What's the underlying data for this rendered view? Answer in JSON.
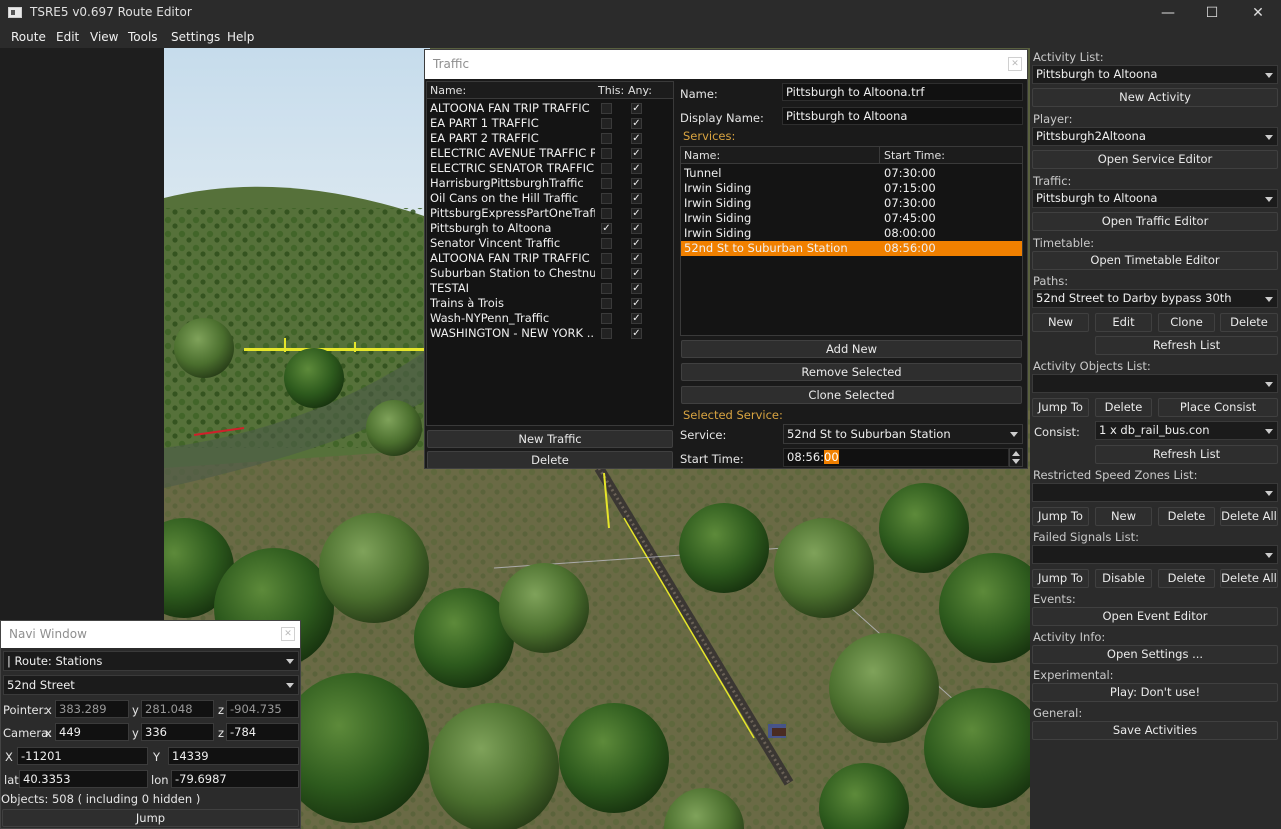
{
  "window": {
    "title": "TSRE5 v0.697 Route Editor",
    "minimize": "—",
    "maximize": "☐",
    "close": "✕"
  },
  "menu": [
    "Route",
    "Edit",
    "View",
    "Tools",
    "Settings",
    "Help"
  ],
  "traffic_window": {
    "title": "Traffic",
    "list_headers": {
      "name": "Name:",
      "this": "This:",
      "any": "Any:"
    },
    "check_glyph": "✓",
    "items": [
      {
        "name": "ALTOONA FAN TRIP TRAFFIC",
        "this": false,
        "any": true
      },
      {
        "name": "EA PART 1 TRAFFIC",
        "this": false,
        "any": true
      },
      {
        "name": "EA PART 2 TRAFFIC",
        "this": false,
        "any": true
      },
      {
        "name": "ELECTRIC AVENUE TRAFFIC P...",
        "this": false,
        "any": true
      },
      {
        "name": "ELECTRIC SENATOR TRAFFIC",
        "this": false,
        "any": true
      },
      {
        "name": "HarrisburgPittsburghTraffic",
        "this": false,
        "any": true
      },
      {
        "name": "Oil Cans on the Hill Traffic",
        "this": false,
        "any": true
      },
      {
        "name": "PittsburgExpressPartOneTraffic",
        "this": false,
        "any": true
      },
      {
        "name": "Pittsburgh to Altoona",
        "this": true,
        "any": true
      },
      {
        "name": "Senator Vincent Traffic",
        "this": false,
        "any": true
      },
      {
        "name": "ALTOONA FAN TRIP TRAFFIC",
        "this": false,
        "any": true
      },
      {
        "name": "Suburban Station to Chestnu...",
        "this": false,
        "any": true
      },
      {
        "name": "TESTAI",
        "this": false,
        "any": true
      },
      {
        "name": "Trains à Trois",
        "this": false,
        "any": true
      },
      {
        "name": "Wash-NYPenn_Traffic",
        "this": false,
        "any": true
      },
      {
        "name": "WASHINGTON - NEW YORK ...",
        "this": false,
        "any": true
      }
    ],
    "new_traffic": "New Traffic",
    "delete": "Delete",
    "name_label": "Name:",
    "name_value": "Pittsburgh to Altoona.trf",
    "display_name_label": "Display Name:",
    "display_name_value": "Pittsburgh to Altoona",
    "services_label": "Services:",
    "services_headers": {
      "name": "Name:",
      "start": "Start Time:"
    },
    "services": [
      {
        "name": "Tunnel",
        "start": "07:30:00",
        "selected": false
      },
      {
        "name": "Irwin Siding",
        "start": "07:15:00",
        "selected": false
      },
      {
        "name": "Irwin Siding",
        "start": "07:30:00",
        "selected": false
      },
      {
        "name": "Irwin Siding",
        "start": "07:45:00",
        "selected": false
      },
      {
        "name": "Irwin Siding",
        "start": "08:00:00",
        "selected": false
      },
      {
        "name": "52nd St to Suburban Station",
        "start": "08:56:00",
        "selected": true
      }
    ],
    "add_new": "Add New",
    "remove_selected": "Remove Selected",
    "clone_selected": "Clone Selected",
    "selected_service_label": "Selected Service:",
    "service_label": "Service:",
    "service_value": "52nd St to Suburban Station",
    "start_time_label": "Start Time:",
    "start_time_prefix": "08:56:",
    "start_time_highlight": "00",
    "selection_color": "#f08000"
  },
  "right_panel": {
    "activity_list_label": "Activity List:",
    "activity_value": "Pittsburgh to Altoona",
    "new_activity": "New Activity",
    "player_label": "Player:",
    "player_value": "Pittsburgh2Altoona",
    "open_service_editor": "Open Service Editor",
    "traffic_label": "Traffic:",
    "traffic_value": "Pittsburgh to Altoona",
    "open_traffic_editor": "Open Traffic Editor",
    "timetable_label": "Timetable:",
    "open_timetable_editor": "Open Timetable Editor",
    "paths_label": "Paths:",
    "paths_value": "52nd Street to Darby bypass 30th",
    "path_buttons": [
      "New",
      "Edit",
      "Clone",
      "Delete"
    ],
    "refresh_list": "Refresh List",
    "activity_objects_label": "Activity Objects List:",
    "jump_to": "Jump To",
    "delete": "Delete",
    "place_consist": "Place Consist",
    "consist_label": "Consist:",
    "consist_value": "1 x db_rail_bus.con",
    "restricted_label": "Restricted Speed Zones List:",
    "new": "New",
    "delete_all": "Delete All",
    "failed_signals_label": "Failed Signals List:",
    "disable": "Disable",
    "events_label": "Events:",
    "open_event_editor": "Open Event Editor",
    "activity_info_label": "Activity Info:",
    "open_settings": "Open Settings ...",
    "experimental_label": "Experimental:",
    "play": "Play: Don't use!",
    "general_label": "General:",
    "save_activities": "Save Activities"
  },
  "navi": {
    "title": "Navi Window",
    "route_value": "| Route: Stations",
    "station_value": "52nd Street",
    "pointer_label": "Pointer:",
    "camera_label": "Camera:",
    "x": "x",
    "y": "y",
    "z": "z",
    "pointer": {
      "x": "383.289",
      "y": "281.048",
      "z": "-904.735"
    },
    "camera": {
      "x": "449",
      "y": "336",
      "z": "-784"
    },
    "X_label": "X",
    "Y_label": "Y",
    "X_value": "-11201",
    "Y_value": "14339",
    "lat_label": "lat",
    "lon_label": "lon",
    "lat_value": "40.3353",
    "lon_value": "-79.6987",
    "objects": "Objects: 508 ( including 0 hidden )",
    "jump": "Jump"
  }
}
